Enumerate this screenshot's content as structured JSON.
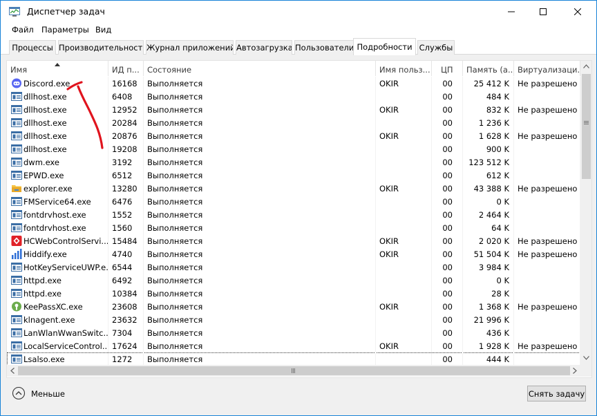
{
  "window": {
    "title": "Диспетчер задач",
    "minimize": "minimize",
    "maximize": "maximize",
    "close": "close"
  },
  "menu": [
    "Файл",
    "Параметры",
    "Вид"
  ],
  "tabs": [
    "Процессы",
    "Производительность",
    "Журнал приложений",
    "Автозагрузка",
    "Пользователи",
    "Подробности",
    "Службы"
  ],
  "active_tab": "Подробности",
  "columns": [
    "Имя",
    "ИД п...",
    "Состояние",
    "Имя польз...",
    "ЦП",
    "Память (а...",
    "Виртуализаци..."
  ],
  "processes": [
    {
      "name": "Discord.exe",
      "pid": "16168",
      "status": "Выполняется",
      "user": "OKIR",
      "cpu": "00",
      "mem": "25 412 K",
      "virt": "Не разрешено",
      "icon": "discord-icon"
    },
    {
      "name": "dllhost.exe",
      "pid": "6408",
      "status": "Выполняется",
      "user": "",
      "cpu": "00",
      "mem": "484 K",
      "virt": "",
      "icon": "window-exe-icon"
    },
    {
      "name": "dllhost.exe",
      "pid": "12952",
      "status": "Выполняется",
      "user": "OKIR",
      "cpu": "00",
      "mem": "832 K",
      "virt": "Не разрешено",
      "icon": "window-exe-icon"
    },
    {
      "name": "dllhost.exe",
      "pid": "20284",
      "status": "Выполняется",
      "user": "",
      "cpu": "00",
      "mem": "1 236 K",
      "virt": "",
      "icon": "window-exe-icon"
    },
    {
      "name": "dllhost.exe",
      "pid": "20876",
      "status": "Выполняется",
      "user": "OKIR",
      "cpu": "00",
      "mem": "1 628 K",
      "virt": "Не разрешено",
      "icon": "window-exe-icon"
    },
    {
      "name": "dllhost.exe",
      "pid": "19208",
      "status": "Выполняется",
      "user": "",
      "cpu": "00",
      "mem": "900 K",
      "virt": "",
      "icon": "window-exe-icon"
    },
    {
      "name": "dwm.exe",
      "pid": "3192",
      "status": "Выполняется",
      "user": "",
      "cpu": "00",
      "mem": "123 512 K",
      "virt": "",
      "icon": "window-exe-icon"
    },
    {
      "name": "EPWD.exe",
      "pid": "6512",
      "status": "Выполняется",
      "user": "",
      "cpu": "00",
      "mem": "612 K",
      "virt": "",
      "icon": "window-exe-icon"
    },
    {
      "name": "explorer.exe",
      "pid": "13280",
      "status": "Выполняется",
      "user": "OKIR",
      "cpu": "00",
      "mem": "43 388 K",
      "virt": "Не разрешено",
      "icon": "folder-icon"
    },
    {
      "name": "FMService64.exe",
      "pid": "6476",
      "status": "Выполняется",
      "user": "",
      "cpu": "00",
      "mem": "0 K",
      "virt": "",
      "icon": "window-exe-icon"
    },
    {
      "name": "fontdrvhost.exe",
      "pid": "1552",
      "status": "Выполняется",
      "user": "",
      "cpu": "00",
      "mem": "2 464 K",
      "virt": "",
      "icon": "window-exe-icon"
    },
    {
      "name": "fontdrvhost.exe",
      "pid": "1560",
      "status": "Выполняется",
      "user": "",
      "cpu": "00",
      "mem": "64 K",
      "virt": "",
      "icon": "window-exe-icon"
    },
    {
      "name": "HCWebControlServi...",
      "pid": "15484",
      "status": "Выполняется",
      "user": "OKIR",
      "cpu": "00",
      "mem": "2 020 K",
      "virt": "Не разрешено",
      "icon": "hc-red-icon"
    },
    {
      "name": "Hiddify.exe",
      "pid": "4740",
      "status": "Выполняется",
      "user": "OKIR",
      "cpu": "00",
      "mem": "51 504 K",
      "virt": "Не разрешено",
      "icon": "hiddify-icon"
    },
    {
      "name": "HotKeyServiceUWP.e...",
      "pid": "6544",
      "status": "Выполняется",
      "user": "",
      "cpu": "00",
      "mem": "3 984 K",
      "virt": "",
      "icon": "window-exe-icon"
    },
    {
      "name": "httpd.exe",
      "pid": "6492",
      "status": "Выполняется",
      "user": "",
      "cpu": "00",
      "mem": "0 K",
      "virt": "",
      "icon": "window-exe-icon"
    },
    {
      "name": "httpd.exe",
      "pid": "10384",
      "status": "Выполняется",
      "user": "",
      "cpu": "00",
      "mem": "28 K",
      "virt": "",
      "icon": "window-exe-icon"
    },
    {
      "name": "KeePassXC.exe",
      "pid": "23608",
      "status": "Выполняется",
      "user": "OKIR",
      "cpu": "00",
      "mem": "1 368 K",
      "virt": "Не разрешено",
      "icon": "keepass-icon"
    },
    {
      "name": "klnagent.exe",
      "pid": "23632",
      "status": "Выполняется",
      "user": "",
      "cpu": "00",
      "mem": "21 996 K",
      "virt": "",
      "icon": "window-exe-icon"
    },
    {
      "name": "LanWlanWwanSwitc...",
      "pid": "7304",
      "status": "Выполняется",
      "user": "",
      "cpu": "00",
      "mem": "436 K",
      "virt": "",
      "icon": "window-exe-icon"
    },
    {
      "name": "LocalServiceControl....",
      "pid": "17624",
      "status": "Выполняется",
      "user": "OKIR",
      "cpu": "00",
      "mem": "1 928 K",
      "virt": "Не разрешено",
      "icon": "window-exe-icon"
    },
    {
      "name": "Lsalso.exe",
      "pid": "1272",
      "status": "Выполняется",
      "user": "",
      "cpu": "00",
      "mem": "444 K",
      "virt": "",
      "icon": "window-exe-icon"
    }
  ],
  "footer": {
    "less": "Меньше",
    "end_task": "Снять задачу"
  },
  "colors": {
    "accent": "#1883d7",
    "annotation": "#e0141e",
    "selected_tab_bg": "#ffffff"
  }
}
